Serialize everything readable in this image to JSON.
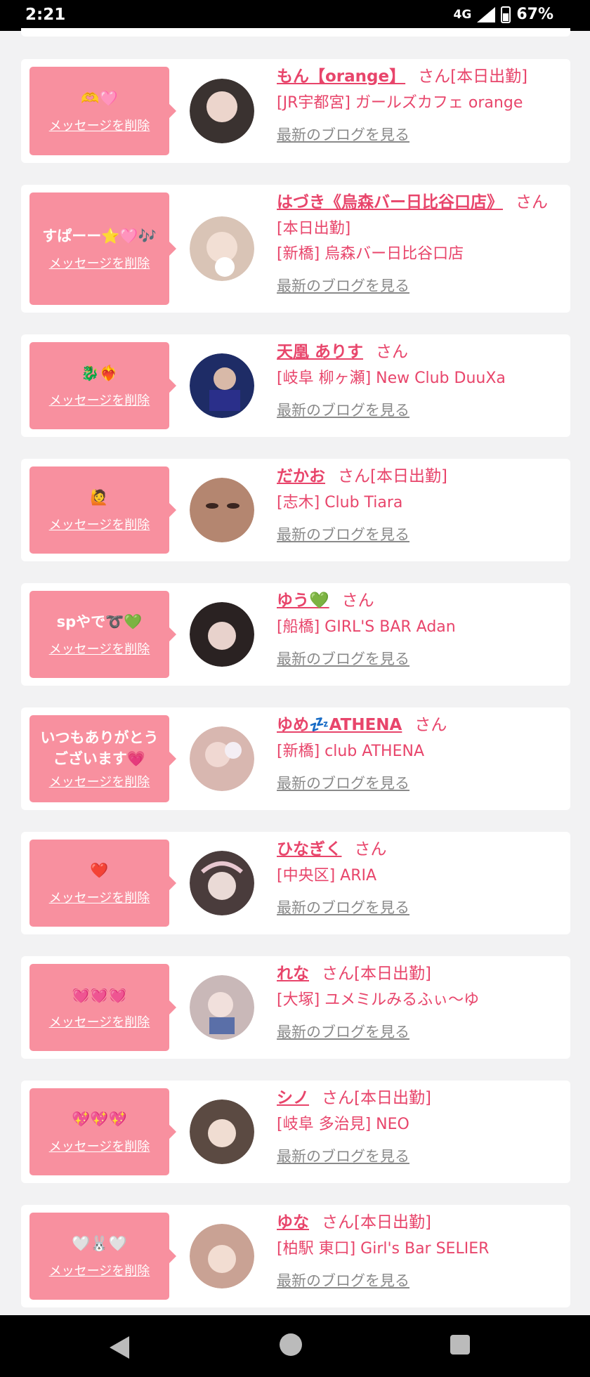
{
  "status": {
    "time": "2:21",
    "network": "4G",
    "battery": "67%"
  },
  "delete_label": "メッセージを削除",
  "blog_label": "最新のブログを見る",
  "cards": [
    {
      "msg": "🫶🩷",
      "name": "もん【orange】",
      "suffix": "さん[本日出勤]",
      "shop": "[JR宇都宮] ガールズカフェ orange",
      "avatar_color": "#3a3230"
    },
    {
      "msg": "すぱーー⭐️🩷🎶",
      "name": "はづき《烏森バー日比谷口店》",
      "suffix": "さん",
      "shop": "[本日出勤]",
      "shop2": "[新橋] 烏森バー日比谷口店",
      "avatar_color": "#d9c4b6"
    },
    {
      "msg": "🐉❤️‍🔥",
      "name": "天凰 ありす",
      "suffix": "さん",
      "shop": "[岐阜 柳ヶ瀬] New Club DuuXa",
      "avatar_color": "#1e2c66"
    },
    {
      "msg": "🙋",
      "name": "だかお",
      "suffix": "さん[本日出勤]",
      "shop": "[志木] Club Tiara",
      "avatar_color": "#b48670"
    },
    {
      "msg": "spやで➰💚",
      "name": "ゆう💚",
      "suffix": "さん",
      "shop": "[船橋] GIRL'S BAR Adan",
      "avatar_color": "#2a2222"
    },
    {
      "msg": "いつもありがとうございます💗",
      "name": "ゆめ💤ATHENA",
      "suffix": "さん",
      "shop": "[新橋] club ATHENA",
      "avatar_color": "#d8b7b0"
    },
    {
      "msg": "❤️",
      "name": "ひなぎく",
      "suffix": "さん",
      "shop": "[中央区] ARIA",
      "avatar_color": "#4a3c3c"
    },
    {
      "msg": "💓💓💓",
      "name": "れな",
      "suffix": "さん[本日出勤]",
      "shop": "[大塚] ユメミルみるふぃ〜ゆ",
      "avatar_color": "#c9b8b8"
    },
    {
      "msg": "💖💖💖",
      "name": "シノ",
      "suffix": "さん[本日出勤]",
      "shop": "[岐阜 多治見] NEO",
      "avatar_color": "#5b4a42"
    },
    {
      "msg": "🤍🐰🤍",
      "name": "ゆな",
      "suffix": "さん[本日出勤]",
      "shop": "[柏駅 東口] Girl's Bar SELIER",
      "avatar_color": "#c9a294"
    }
  ]
}
